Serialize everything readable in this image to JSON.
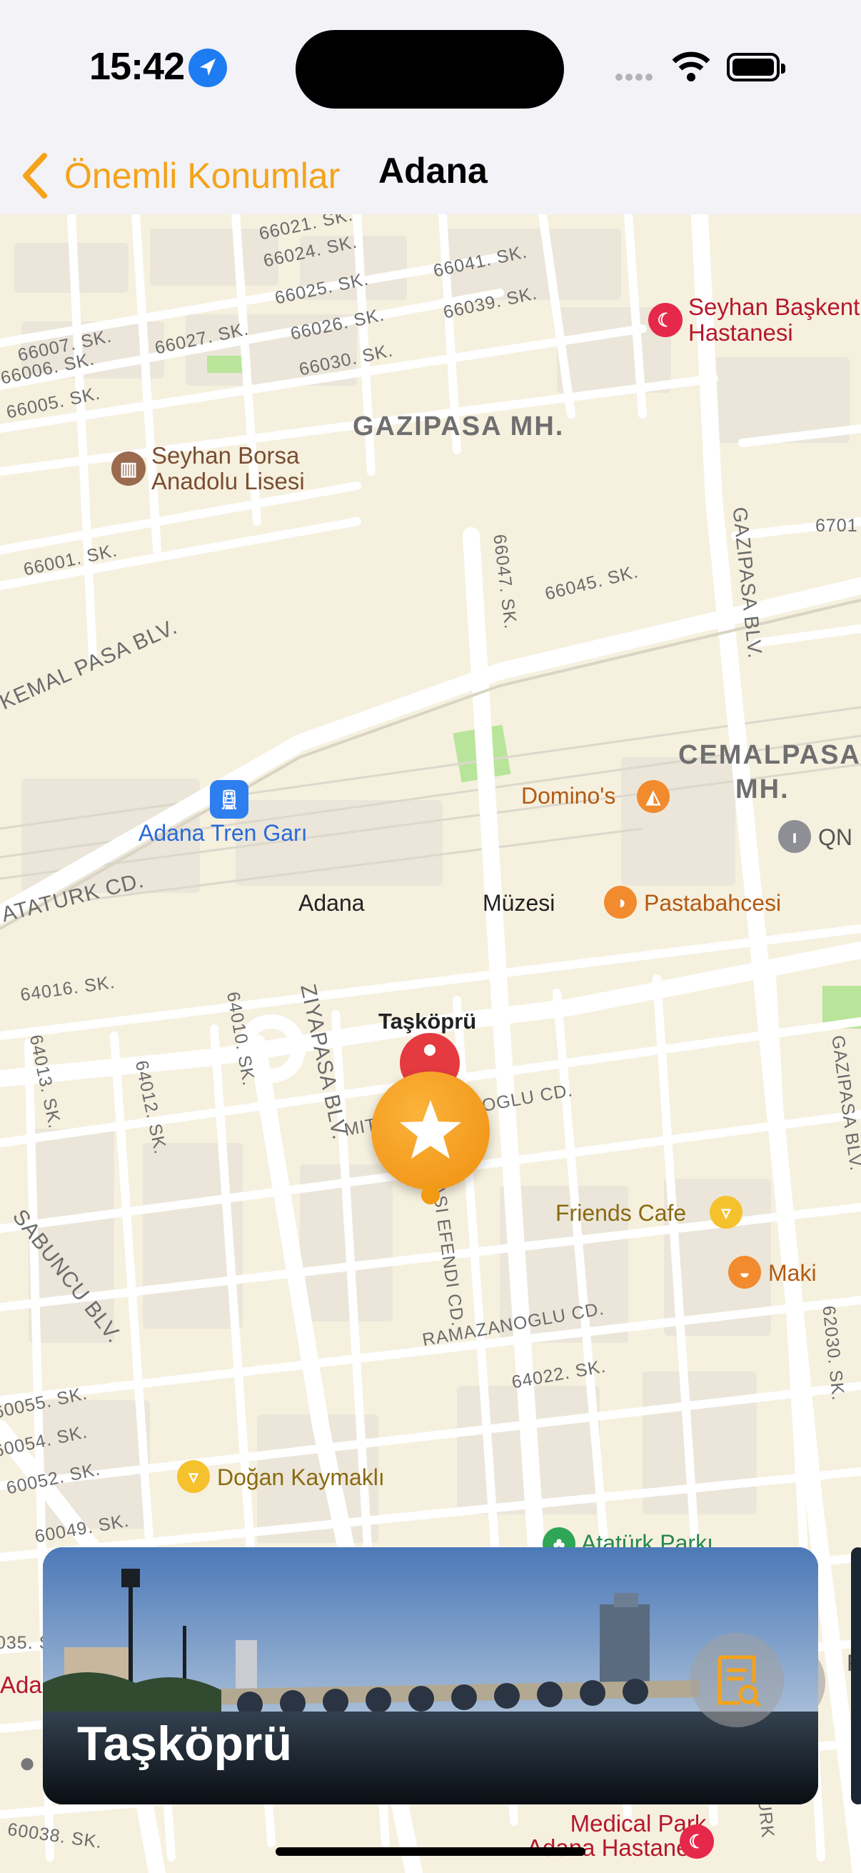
{
  "status": {
    "time": "15:42"
  },
  "nav": {
    "back_label": "Önemli Konumlar",
    "title": "Adana"
  },
  "map": {
    "streets": [
      "66021. SK.",
      "66024. SK.",
      "66025. SK.",
      "66026. SK.",
      "66030. SK.",
      "66027. SK.",
      "66041. SK.",
      "66039. SK.",
      "66007. SK.",
      "66006. SK.",
      "66005. SK.",
      "66001. SK.",
      "66047. SK.",
      "66045. SK.",
      "6701",
      "KEMAL PASA BLV.",
      "GAZIPASA BLV.",
      "ATATURK CD.",
      "64016. SK.",
      "64013. SK.",
      "64012. SK.",
      "64010. SK.",
      "ZIYAPASA BLV.",
      "MITHAT SARACOGLU CD.",
      "SINASI EFENDI CD.",
      "GAZIPASA BLV.",
      "SABUNCU BLV.",
      "RAMAZANOGLU CD.",
      "64022. SK.",
      "62030. SK.",
      "60055. SK.",
      "60054. SK.",
      "60052. SK.",
      "60049. SK.",
      "035. S",
      "60038. SK.",
      "ATATURK"
    ],
    "districts": {
      "gazipasa": "GAZIPASA MH.",
      "cemalpasa_1": "CEMALPASA",
      "cemalpasa_2": "MH."
    },
    "pois": {
      "hospital": {
        "line1": "Seyhan Başkent",
        "line2": "Hastanesi"
      },
      "school": {
        "line1": "Seyhan Borsa",
        "line2": "Anadolu Lisesi"
      },
      "train": "Adana Tren Garı",
      "dominos": "Domino's",
      "qn": "QN",
      "museum_left": "Adana",
      "museum_right": "Müzesi",
      "pastabahcesi": "Pastabahcesi",
      "taskopru": "Taşköprü",
      "friends": "Friends Cafe",
      "maki": "Maki",
      "dogan": "Doğan Kaymaklı",
      "ataturk_park": "Atatürk Parkı",
      "medical": {
        "line1": "Medical Park",
        "line2": "Adana Hastanesi"
      },
      "edge_left": "Adan",
      "edge_r": "R"
    }
  },
  "card": {
    "title": "Taşköprü"
  },
  "colors": {
    "accent": "#F4A31A",
    "map_bg": "#F6F0DF",
    "pin_red": "#E53A40"
  },
  "icons": [
    "location-arrow-icon",
    "wifi-icon",
    "battery-icon",
    "chevron-left-icon",
    "hospital-icon",
    "school-icon",
    "train-icon",
    "pizza-icon",
    "bakery-icon",
    "star-pin-icon",
    "basket-icon",
    "sushi-icon",
    "tree-icon",
    "compass-icon",
    "document-search-icon",
    "apple-logo-icon"
  ]
}
